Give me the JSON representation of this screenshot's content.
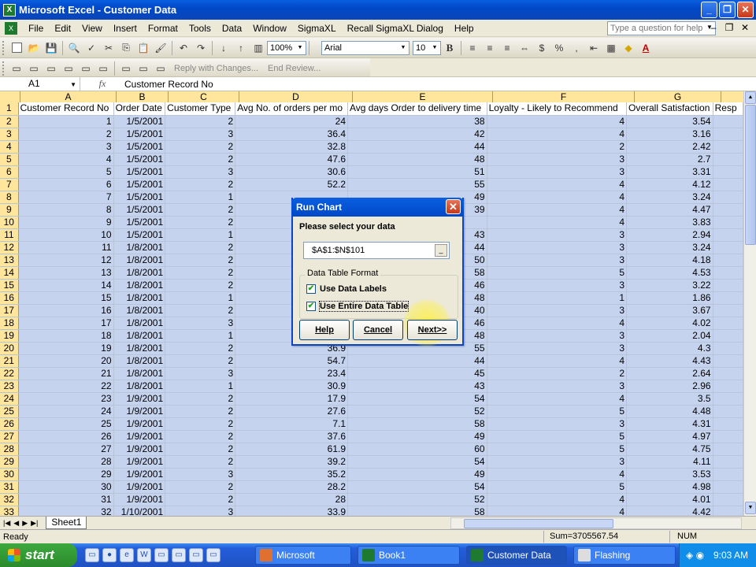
{
  "window": {
    "title": "Microsoft Excel - Customer Data"
  },
  "menu": [
    "File",
    "Edit",
    "View",
    "Insert",
    "Format",
    "Tools",
    "Data",
    "Window",
    "SigmaXL",
    "Recall SigmaXL Dialog",
    "Help"
  ],
  "help_placeholder": "Type a question for help",
  "toolbar": {
    "zoom": "100%",
    "font": "Arial",
    "size": "10",
    "bold": "B",
    "reply": "Reply with Changes...",
    "end_review": "End Review..."
  },
  "formula": {
    "cell": "A1",
    "fx": "fx",
    "content": "Customer Record No"
  },
  "columns": [
    {
      "letter": "A",
      "header": "Customer Record No"
    },
    {
      "letter": "B",
      "header": "Order Date"
    },
    {
      "letter": "C",
      "header": "Customer Type"
    },
    {
      "letter": "D",
      "header": "Avg No. of orders per mo"
    },
    {
      "letter": "E",
      "header": "Avg days Order to delivery time"
    },
    {
      "letter": "F",
      "header": "Loyalty - Likely to Recommend"
    },
    {
      "letter": "G",
      "header": "Overall Satisfaction"
    },
    {
      "letter": "",
      "header": "Resp"
    }
  ],
  "rows": [
    [
      "1",
      "1/5/2001",
      "2",
      "24",
      "38",
      "4",
      "3.54"
    ],
    [
      "2",
      "1/5/2001",
      "3",
      "36.4",
      "42",
      "4",
      "3.16"
    ],
    [
      "3",
      "1/5/2001",
      "2",
      "32.8",
      "44",
      "2",
      "2.42"
    ],
    [
      "4",
      "1/5/2001",
      "2",
      "47.6",
      "48",
      "3",
      "2.7"
    ],
    [
      "5",
      "1/5/2001",
      "3",
      "30.6",
      "51",
      "3",
      "3.31"
    ],
    [
      "6",
      "1/5/2001",
      "2",
      "52.2",
      "55",
      "4",
      "4.12"
    ],
    [
      "7",
      "1/5/2001",
      "1",
      "",
      "49",
      "4",
      "3.24"
    ],
    [
      "8",
      "1/5/2001",
      "2",
      "",
      "39",
      "4",
      "4.47"
    ],
    [
      "9",
      "1/5/2001",
      "2",
      "",
      "",
      "4",
      "3.83"
    ],
    [
      "10",
      "1/5/2001",
      "1",
      "",
      "43",
      "3",
      "2.94"
    ],
    [
      "11",
      "1/8/2001",
      "2",
      "",
      "44",
      "3",
      "3.24"
    ],
    [
      "12",
      "1/8/2001",
      "2",
      "",
      "50",
      "3",
      "4.18"
    ],
    [
      "13",
      "1/8/2001",
      "2",
      "",
      "58",
      "5",
      "4.53"
    ],
    [
      "14",
      "1/8/2001",
      "2",
      "",
      "46",
      "3",
      "3.22"
    ],
    [
      "15",
      "1/8/2001",
      "1",
      "",
      "48",
      "1",
      "1.86"
    ],
    [
      "16",
      "1/8/2001",
      "2",
      "",
      "40",
      "3",
      "3.67"
    ],
    [
      "17",
      "1/8/2001",
      "3",
      "",
      "46",
      "4",
      "4.02"
    ],
    [
      "18",
      "1/8/2001",
      "1",
      "",
      "48",
      "3",
      "2.04"
    ],
    [
      "19",
      "1/8/2001",
      "2",
      "36.9",
      "55",
      "3",
      "4.3"
    ],
    [
      "20",
      "1/8/2001",
      "2",
      "54.7",
      "44",
      "4",
      "4.43"
    ],
    [
      "21",
      "1/8/2001",
      "3",
      "23.4",
      "45",
      "2",
      "2.64"
    ],
    [
      "22",
      "1/8/2001",
      "1",
      "30.9",
      "43",
      "3",
      "2.96"
    ],
    [
      "23",
      "1/9/2001",
      "2",
      "17.9",
      "54",
      "4",
      "3.5"
    ],
    [
      "24",
      "1/9/2001",
      "2",
      "27.6",
      "52",
      "5",
      "4.48"
    ],
    [
      "25",
      "1/9/2001",
      "2",
      "7.1",
      "58",
      "3",
      "4.31"
    ],
    [
      "26",
      "1/9/2001",
      "2",
      "37.6",
      "49",
      "5",
      "4.97"
    ],
    [
      "27",
      "1/9/2001",
      "2",
      "61.9",
      "60",
      "5",
      "4.75"
    ],
    [
      "28",
      "1/9/2001",
      "2",
      "39.2",
      "54",
      "3",
      "4.11"
    ],
    [
      "29",
      "1/9/2001",
      "3",
      "35.2",
      "49",
      "4",
      "3.53"
    ],
    [
      "30",
      "1/9/2001",
      "2",
      "28.2",
      "54",
      "5",
      "4.98"
    ],
    [
      "31",
      "1/9/2001",
      "2",
      "28",
      "52",
      "4",
      "4.01"
    ],
    [
      "32",
      "1/10/2001",
      "3",
      "33.9",
      "58",
      "4",
      "4.42"
    ]
  ],
  "sheet_tab": "Sheet1",
  "status": {
    "ready": "Ready",
    "sum": "Sum=3705567.54",
    "num": "NUM"
  },
  "dialog": {
    "title": "Run Chart",
    "prompt": "Please select your data",
    "range": "$A$1:$N$101",
    "group_label": "Data Table Format",
    "opt1": "Use Data Labels",
    "opt2": "Use Entire Data Table",
    "help": "Help",
    "cancel": "Cancel",
    "next": "Next>>"
  },
  "taskbar": {
    "start": "start",
    "tasks": [
      "Microsoft PowerP...",
      "Book1",
      "Customer Data",
      "Flashing"
    ],
    "clock": "9:03 AM"
  }
}
